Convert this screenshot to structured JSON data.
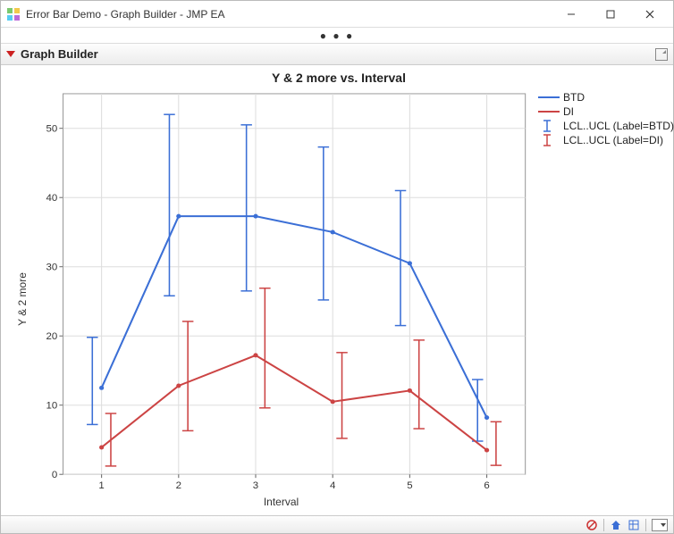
{
  "window": {
    "title": "Error Bar Demo - Graph Builder - JMP EA",
    "overflow_glyph": "● ● ●"
  },
  "report": {
    "title": "Graph Builder"
  },
  "chart_data": {
    "type": "line",
    "title": "Y & 2 more vs. Interval",
    "xlabel": "Interval",
    "ylabel": "Y & 2 more",
    "xlim": [
      0.5,
      6.5
    ],
    "ylim": [
      0,
      55
    ],
    "xticks": [
      1,
      2,
      3,
      4,
      5,
      6
    ],
    "yticks": [
      0,
      10,
      20,
      30,
      40,
      50
    ],
    "categories": [
      1,
      2,
      3,
      4,
      5,
      6
    ],
    "series": [
      {
        "name": "BTD",
        "color": "#3b6fd6",
        "values": [
          12.5,
          37.3,
          37.3,
          35.0,
          30.5,
          8.2
        ],
        "lcl": [
          7.2,
          25.8,
          26.5,
          25.2,
          21.5,
          4.8
        ],
        "ucl": [
          19.8,
          52.0,
          50.5,
          47.3,
          41.0,
          13.7
        ],
        "error_x_offset": -0.12
      },
      {
        "name": "DI",
        "color": "#cc4444",
        "values": [
          3.9,
          12.8,
          17.2,
          10.5,
          12.1,
          3.5
        ],
        "lcl": [
          1.2,
          6.3,
          9.6,
          5.2,
          6.6,
          1.3
        ],
        "ucl": [
          8.8,
          22.1,
          26.9,
          17.6,
          19.4,
          7.6
        ],
        "error_x_offset": 0.12
      }
    ],
    "legend": [
      {
        "kind": "line",
        "label": "BTD",
        "color": "#3b6fd6"
      },
      {
        "kind": "line",
        "label": "DI",
        "color": "#cc4444"
      },
      {
        "kind": "error",
        "label": "LCL..UCL (Label=BTD)",
        "color": "#3b6fd6"
      },
      {
        "kind": "error",
        "label": "LCL..UCL (Label=DI)",
        "color": "#cc4444"
      }
    ]
  }
}
